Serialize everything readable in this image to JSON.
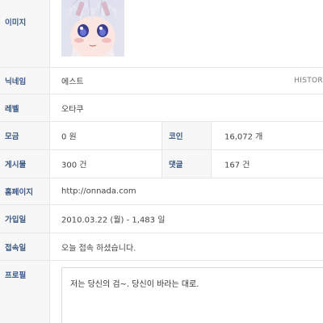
{
  "profile": {
    "image_label": "이미지",
    "nickname_label": "닉네임",
    "nickname": "에스트",
    "history_link": "HISTOR",
    "level_label": "레벨",
    "level": "오타쿠",
    "donation_label": "모금",
    "donation": "0 원",
    "coin_label": "코인",
    "coin": "16,072 개",
    "posts_label": "게시물",
    "posts": "300 건",
    "comments_label": "댓글",
    "comments": "167 건",
    "homepage_label": "홈페이지",
    "homepage": "http://onnada.com",
    "joined_label": "가입일",
    "joined": "2010.03.22 (월) - 1,483 일",
    "last_access_label": "접속일",
    "last_access": "오늘 접속 하셨습니다.",
    "intro_label": "프로필",
    "intro": "저는 당신의 검~. 당신이 바라는 대로."
  },
  "colors": {
    "label_text": "#3a5a86",
    "label_bg": "#f7f7f7",
    "border": "#e6e6e6"
  },
  "icons": {
    "avatar": "anime-girl-avatar"
  }
}
